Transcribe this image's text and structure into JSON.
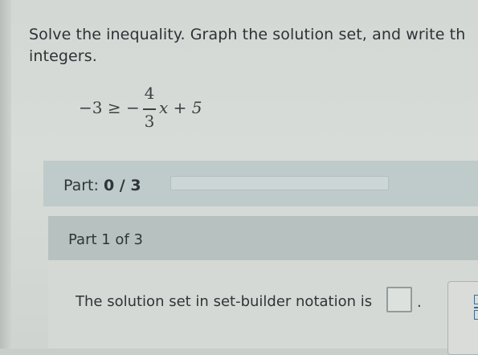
{
  "question": {
    "line1": "Solve the inequality. Graph the solution set, and write th",
    "line2": "integers."
  },
  "inequality": {
    "lhs": "−3 ≥ −",
    "numerator": "4",
    "denominator": "3",
    "rhs": "x + 5"
  },
  "progress": {
    "label": "Part:",
    "value": "0 / 3",
    "completed": 0,
    "total": 3
  },
  "part1": {
    "title": "Part 1 of 3",
    "prompt": "The solution set in set-builder notation is",
    "period": "."
  },
  "icons": [
    "fraction-icon"
  ]
}
